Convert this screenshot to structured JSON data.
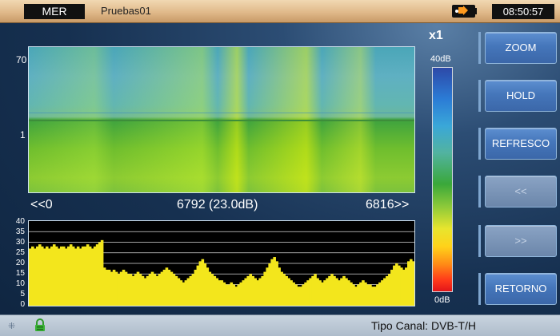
{
  "header": {
    "mode": "MER",
    "title": "Pruebas01",
    "clock": "08:50:57",
    "battery_icon": "battery-plug-icon"
  },
  "spectrogram": {
    "y_labels": [
      "70",
      "1"
    ],
    "x_left": "<<0",
    "x_center": "6792 (23.0dB)",
    "x_right": "6816>>"
  },
  "level_bar": {
    "multiplier": "x1",
    "top_label": "40dB",
    "bottom_label": "0dB"
  },
  "buttons": [
    {
      "label": "ZOOM",
      "enabled": true
    },
    {
      "label": "HOLD",
      "enabled": true
    },
    {
      "label": "REFRESCO",
      "enabled": true
    },
    {
      "label": "<<",
      "enabled": false
    },
    {
      "label": ">>",
      "enabled": false
    },
    {
      "label": "RETORNO",
      "enabled": true
    }
  ],
  "footer": {
    "canal": "Tipo Canal: DVB-T/H",
    "lock_icon": "lock-icon",
    "signal_icon": "signal-icon"
  },
  "chart_data": {
    "type": "area",
    "ylim": [
      0,
      40
    ],
    "y_ticks": [
      "40",
      "35",
      "30",
      "25",
      "20",
      "15",
      "10",
      "5",
      "0"
    ],
    "values": [
      27,
      28,
      27,
      28,
      29,
      28,
      27,
      28,
      27,
      28,
      29,
      28,
      27,
      28,
      28,
      27,
      28,
      29,
      28,
      27,
      28,
      27,
      28,
      28,
      29,
      28,
      27,
      28,
      29,
      30,
      31,
      18,
      17,
      17,
      16,
      17,
      16,
      15,
      16,
      17,
      16,
      15,
      15,
      14,
      15,
      16,
      15,
      14,
      13,
      14,
      15,
      16,
      15,
      14,
      15,
      16,
      17,
      18,
      17,
      16,
      15,
      14,
      13,
      12,
      11,
      12,
      13,
      14,
      15,
      17,
      19,
      21,
      22,
      20,
      18,
      16,
      15,
      14,
      13,
      12,
      12,
      11,
      10,
      10,
      11,
      10,
      9,
      10,
      11,
      12,
      13,
      14,
      15,
      14,
      13,
      12,
      13,
      14,
      16,
      18,
      20,
      22,
      23,
      21,
      18,
      16,
      15,
      14,
      13,
      12,
      11,
      10,
      9,
      9,
      10,
      11,
      12,
      13,
      14,
      15,
      13,
      12,
      11,
      12,
      13,
      14,
      15,
      14,
      13,
      12,
      13,
      14,
      13,
      12,
      11,
      10,
      9,
      10,
      11,
      12,
      11,
      10,
      10,
      9,
      9,
      10,
      11,
      12,
      13,
      14,
      15,
      17,
      19,
      20,
      19,
      18,
      17,
      18,
      21,
      22,
      21
    ]
  }
}
